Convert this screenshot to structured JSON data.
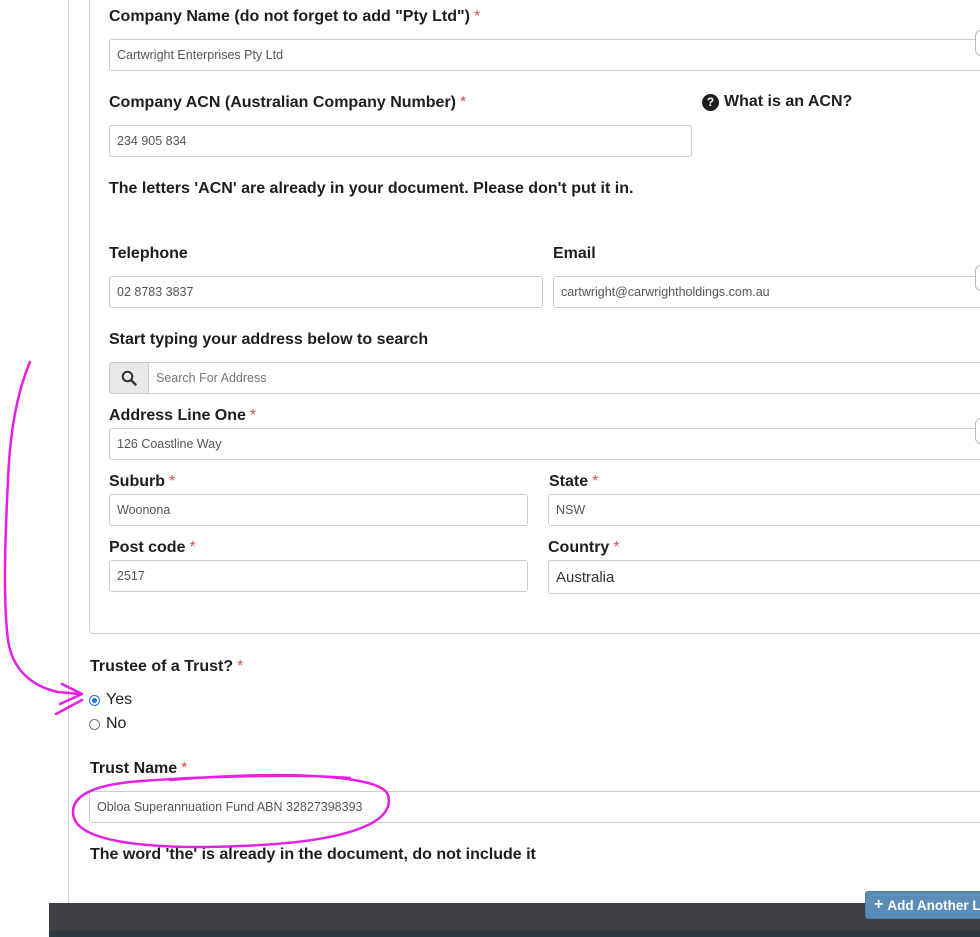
{
  "company": {
    "name_label": "Company Name (do not forget to add \"Pty Ltd\")",
    "name_value": "Cartwright Enterprises Pty Ltd",
    "acn_label": "Company ACN (Australian Company Number)",
    "acn_value": "234 905 834",
    "acn_help": "What is an ACN?",
    "acn_note": "The letters 'ACN' are already in your document. Please don't put it in."
  },
  "contact": {
    "telephone_label": "Telephone",
    "telephone_value": "02 8783 3837",
    "email_label": "Email",
    "email_value": "cartwright@carwrightholdings.com.au"
  },
  "address": {
    "search_label": "Start typing your address below to search",
    "search_placeholder": "Search For Address",
    "line_one_label": "Address Line One",
    "line_one_value": "126 Coastline Way",
    "suburb_label": "Suburb",
    "suburb_value": "Woonona",
    "state_label": "State",
    "state_value": "NSW",
    "postcode_label": "Post code",
    "postcode_value": "2517",
    "country_label": "Country",
    "country_value": "Australia"
  },
  "required_mark": "*",
  "trust": {
    "question_label": "Trustee of a Trust?",
    "option_yes": "Yes",
    "option_no": "No",
    "selected": "Yes",
    "name_label": "Trust Name",
    "name_value": "Obloa Superannuation Fund ABN 32827398393",
    "note": "The word 'the' is already in the document, do not include it"
  },
  "footer": {
    "add_button_label": "Add Another Le"
  },
  "colors": {
    "required": "#d9534f",
    "annotation": "#e61ee6",
    "button_bg": "#5b8db8"
  }
}
